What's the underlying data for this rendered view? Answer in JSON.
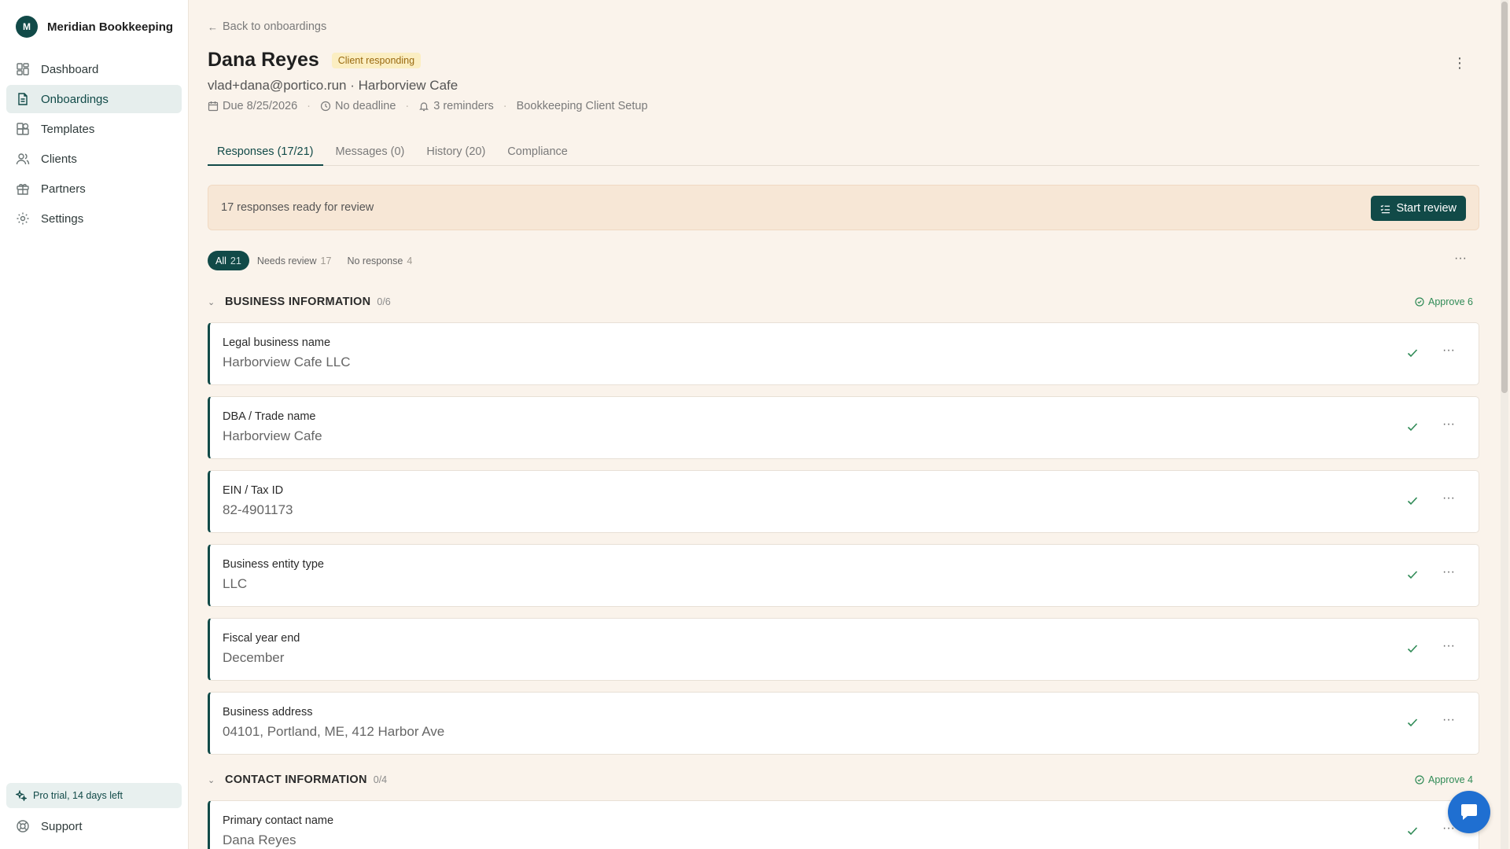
{
  "brand": {
    "initial": "M",
    "name": "Meridian Bookkeeping"
  },
  "sidebar": {
    "items": [
      {
        "label": "Dashboard",
        "icon": "dashboard-icon"
      },
      {
        "label": "Onboardings",
        "icon": "document-icon",
        "active": true
      },
      {
        "label": "Templates",
        "icon": "templates-icon"
      },
      {
        "label": "Clients",
        "icon": "users-icon"
      },
      {
        "label": "Partners",
        "icon": "gift-icon"
      },
      {
        "label": "Settings",
        "icon": "gear-icon"
      }
    ],
    "trial": "Pro trial, 14 days left",
    "support": "Support"
  },
  "header": {
    "back_label": "Back to onboardings",
    "title": "Dana Reyes",
    "status": "Client responding",
    "subtitle": "vlad+dana@portico.run · Harborview Cafe",
    "due": "Due 8/25/2026",
    "deadline": "No deadline",
    "reminders": "3 reminders",
    "template": "Bookkeeping Client Setup"
  },
  "tabs": [
    {
      "label": "Responses (17/21)",
      "active": true
    },
    {
      "label": "Messages (0)"
    },
    {
      "label": "History (20)"
    },
    {
      "label": "Compliance"
    }
  ],
  "banner": {
    "text": "17 responses ready for review",
    "button": "Start review"
  },
  "filters": [
    {
      "label": "All",
      "count": "21",
      "active": true
    },
    {
      "label": "Needs review",
      "count": "17"
    },
    {
      "label": "No response",
      "count": "4"
    }
  ],
  "sections": [
    {
      "title": "BUSINESS INFORMATION",
      "count": "0/6",
      "approve": "Approve 6",
      "fields": [
        {
          "label": "Legal business name",
          "value": "Harborview Cafe LLC"
        },
        {
          "label": "DBA / Trade name",
          "value": "Harborview Cafe"
        },
        {
          "label": "EIN / Tax ID",
          "value": "82-4901173"
        },
        {
          "label": "Business entity type",
          "value": "LLC"
        },
        {
          "label": "Fiscal year end",
          "value": "December"
        },
        {
          "label": "Business address",
          "value": "04101, Portland, ME, 412 Harbor Ave"
        }
      ]
    },
    {
      "title": "CONTACT INFORMATION",
      "count": "0/4",
      "approve": "Approve 4",
      "fields": [
        {
          "label": "Primary contact name",
          "value": "Dana Reyes"
        }
      ]
    }
  ],
  "colors": {
    "brand": "#114a48",
    "background": "#faf3eb",
    "approve": "#2f8a56",
    "badge_bg": "#fbeec2",
    "chat": "#1f6fd1"
  }
}
